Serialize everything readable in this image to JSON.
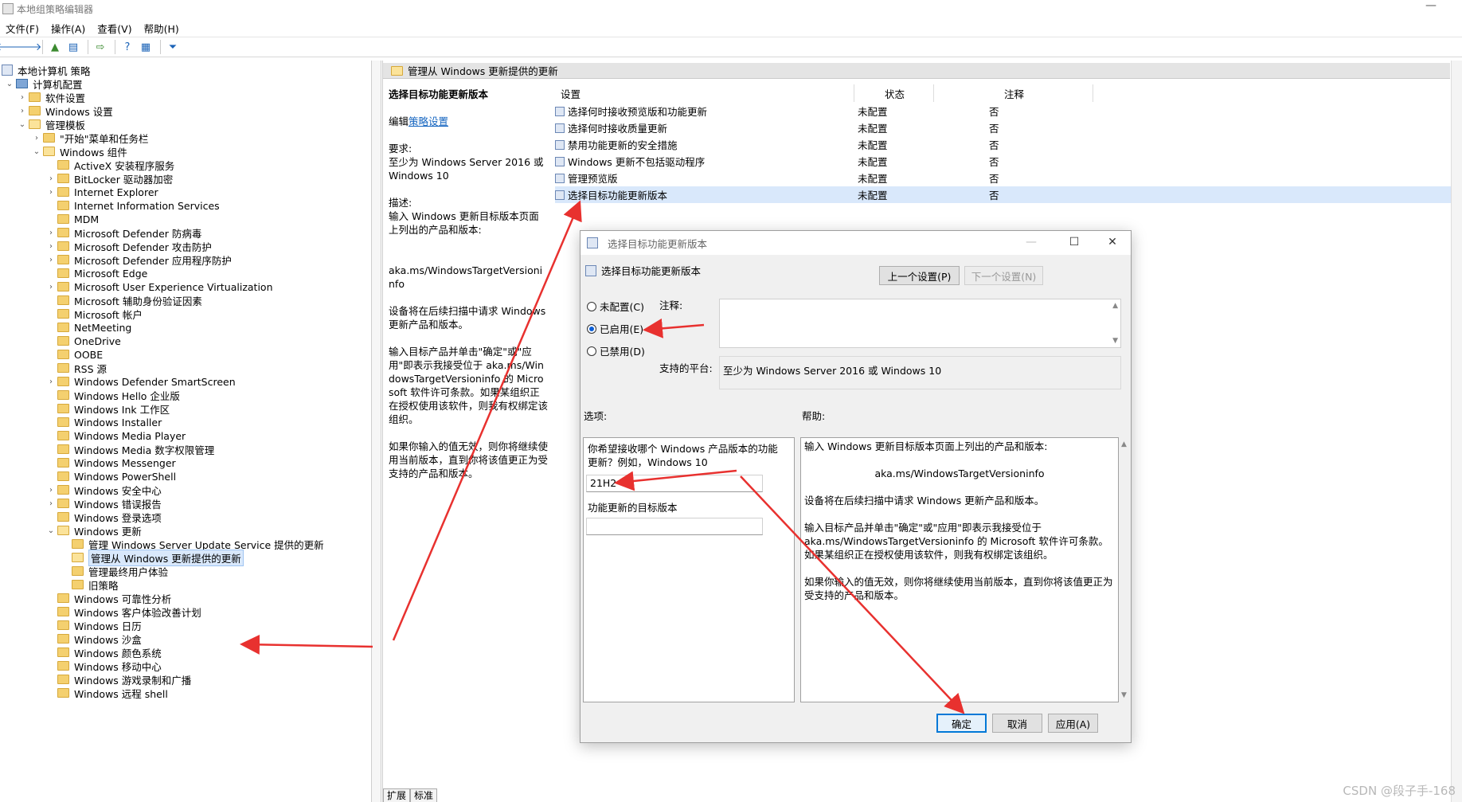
{
  "window": {
    "title": "本地组策略编辑器",
    "minimize": "—"
  },
  "menu": [
    "文件(F)",
    "操作(A)",
    "查看(V)",
    "帮助(H)"
  ],
  "tree": {
    "root": "本地计算机 策略",
    "computer_config": "计算机配置",
    "software_settings": "软件设置",
    "windows_settings": "Windows 设置",
    "admin_templates": "管理模板",
    "start_menu": "\"开始\"菜单和任务栏",
    "windows_components": "Windows 组件",
    "items": [
      "ActiveX 安装程序服务",
      "BitLocker 驱动器加密",
      "Internet Explorer",
      "Internet Information Services",
      "MDM",
      "Microsoft Defender 防病毒",
      "Microsoft Defender 攻击防护",
      "Microsoft Defender 应用程序防护",
      "Microsoft Edge",
      "Microsoft User Experience Virtualization",
      "Microsoft 辅助身份验证因素",
      "Microsoft 帐户",
      "NetMeeting",
      "OneDrive",
      "OOBE",
      "RSS 源",
      "Windows Defender SmartScreen",
      "Windows Hello 企业版",
      "Windows Ink 工作区",
      "Windows Installer",
      "Windows Media Player",
      "Windows Media 数字权限管理",
      "Windows Messenger",
      "Windows PowerShell",
      "Windows 安全中心",
      "Windows 错误报告",
      "Windows 登录选项",
      "Windows 更新"
    ],
    "update_children": [
      "管理 Windows Server Update Service 提供的更新",
      "管理从 Windows 更新提供的更新",
      "管理最终用户体验",
      "旧策略"
    ],
    "after_items": [
      "Windows 可靠性分析",
      "Windows 客户体验改善计划",
      "Windows 日历",
      "Windows 沙盒",
      "Windows 颜色系统",
      "Windows 移动中心",
      "Windows 游戏录制和广播",
      "Windows 远程 shell"
    ]
  },
  "right": {
    "header": "管理从 Windows 更新提供的更新",
    "desc": {
      "title": "选择目标功能更新版本",
      "edit_prefix": "编辑",
      "edit_link": "策略设置",
      "req_label": "要求:",
      "req_text": "至少为 Windows Server 2016 或 Windows 10",
      "desc_label": "描述:",
      "desc_text": "输入 Windows 更新目标版本页面上列出的产品和版本:",
      "url": "aka.ms/WindowsTargetVersioninfo",
      "p1": "设备将在后续扫描中请求 Windows 更新产品和版本。",
      "p2": "输入目标产品并单击\"确定\"或\"应用\"即表示我接受位于 aka.ms/WindowsTargetVersioninfo 的 Microsoft 软件许可条款。如果某组织正在授权使用该软件，则我有权绑定该组织。",
      "p3": "如果你输入的值无效，则你将继续使用当前版本，直到你将该值更正为受支持的产品和版本。"
    },
    "columns": {
      "setting": "设置",
      "state": "状态",
      "comment": "注释"
    },
    "rows": [
      {
        "name": "选择何时接收预览版和功能更新",
        "state": "未配置",
        "comment": "否"
      },
      {
        "name": "选择何时接收质量更新",
        "state": "未配置",
        "comment": "否"
      },
      {
        "name": "禁用功能更新的安全措施",
        "state": "未配置",
        "comment": "否"
      },
      {
        "name": "Windows 更新不包括驱动程序",
        "state": "未配置",
        "comment": "否"
      },
      {
        "name": "管理预览版",
        "state": "未配置",
        "comment": "否"
      },
      {
        "name": "选择目标功能更新版本",
        "state": "未配置",
        "comment": "否"
      }
    ],
    "tabs": [
      "扩展",
      "标准"
    ]
  },
  "dialog": {
    "title": "选择目标功能更新版本",
    "subtitle": "选择目标功能更新版本",
    "prev_button": "上一个设置(P)",
    "next_button": "下一个设置(N)",
    "radio_not_configured": "未配置(C)",
    "radio_enabled": "已启用(E)",
    "radio_disabled": "已禁用(D)",
    "comment_label": "注释:",
    "platform_label": "支持的平台:",
    "platform_value": "至少为 Windows Server 2016 或 Windows 10",
    "options_label": "选项:",
    "help_label": "帮助:",
    "option_prompt": "你希望接收哪个 Windows 产品版本的功能更新？例如，Windows 10",
    "product_value": "21H2",
    "target_label": "功能更新的目标版本",
    "target_value": "",
    "help_text": {
      "p0": "输入 Windows 更新目标版本页面上列出的产品和版本:",
      "url": "aka.ms/WindowsTargetVersioninfo",
      "p1": "设备将在后续扫描中请求 Windows 更新产品和版本。",
      "p2": "输入目标产品并单击\"确定\"或\"应用\"即表示我接受位于 aka.ms/WindowsTargetVersioninfo 的 Microsoft 软件许可条款。如果某组织正在授权使用该软件，则我有权绑定该组织。",
      "p3": "如果你输入的值无效，则你将继续使用当前版本，直到你将该值更正为受支持的产品和版本。"
    },
    "ok": "确定",
    "cancel": "取消",
    "apply": "应用(A)"
  },
  "watermark": "CSDN @段子手-168",
  "colors": {
    "annotation_red": "#e8312f",
    "selection": "#d9e8fb",
    "link": "#1565c0"
  }
}
